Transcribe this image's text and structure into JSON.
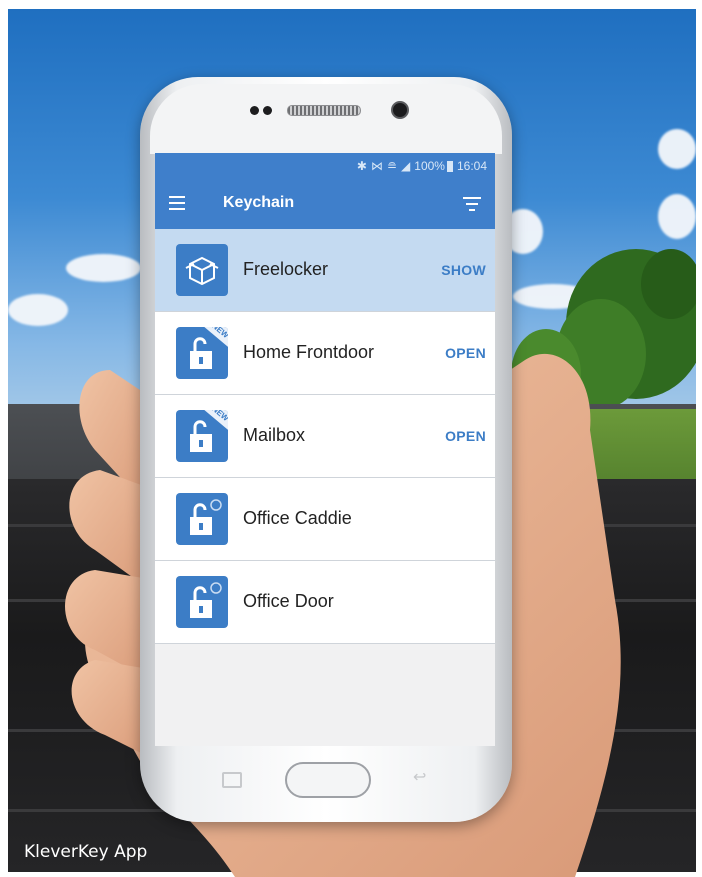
{
  "caption": "KleverKey App",
  "status_bar": {
    "icons": [
      "bluetooth-icon",
      "vibrate-icon",
      "wifi-icon",
      "signal-icon",
      "battery-icon"
    ],
    "battery": "100%",
    "time": "16:04"
  },
  "app_bar": {
    "title": "Keychain",
    "menu_icon": "hamburger-icon",
    "filter_icon": "filter-icon"
  },
  "keychain": {
    "items": [
      {
        "label": "Freelocker",
        "action": "SHOW",
        "icon": "box-icon",
        "badge": "",
        "selected": true
      },
      {
        "label": "Home Frontdoor",
        "action": "OPEN",
        "icon": "padlock-icon",
        "badge": "NEW",
        "selected": false
      },
      {
        "label": "Mailbox",
        "action": "OPEN",
        "icon": "padlock-icon",
        "badge": "NEW",
        "selected": false
      },
      {
        "label": "Office Caddie",
        "action": "",
        "icon": "padlock-icon",
        "badge": "",
        "selected": false
      },
      {
        "label": "Office Door",
        "action": "",
        "icon": "padlock-icon",
        "badge": "",
        "selected": false
      }
    ]
  },
  "colors": {
    "app_bar": "#3f7fcb",
    "selected_row": "#c4daf1",
    "accent": "#3c7dc6"
  }
}
